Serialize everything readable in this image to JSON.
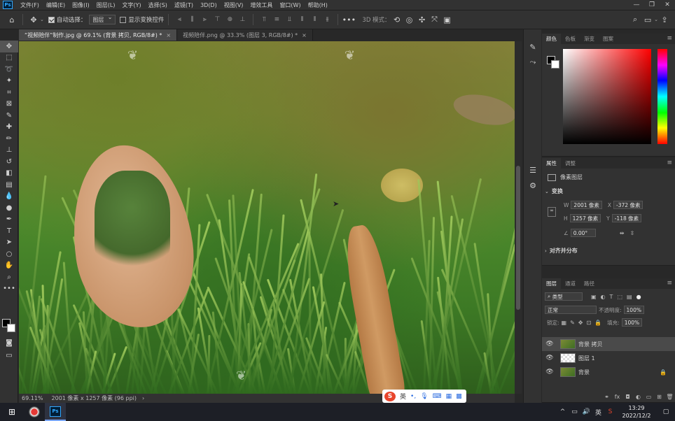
{
  "menubar": {
    "logo": "Ps",
    "items": [
      "文件(F)",
      "编辑(E)",
      "图像(I)",
      "图层(L)",
      "文字(Y)",
      "选择(S)",
      "滤镜(T)",
      "3D(D)",
      "视图(V)",
      "增效工具",
      "窗口(W)",
      "帮助(H)"
    ],
    "window_controls": [
      "—",
      "❐",
      "✕"
    ]
  },
  "options": {
    "auto_select_label": "自动选择：",
    "auto_select_value": "图层",
    "show_transform_label": "显示变换控件",
    "mode_3d_label": "3D 模式："
  },
  "tabs": [
    {
      "label": "“视频陪伴”制作.jpg @ 69.1% (背景 拷贝, RGB/8#) *",
      "close": "×"
    },
    {
      "label": "视频陪伴.png @ 33.3% (图层 3, RGB/8#) *",
      "close": "×"
    }
  ],
  "status": {
    "zoom": "69.11%",
    "doc_info": "2001 像素 x 1257 像素 (96 ppi)",
    "arrow": "›"
  },
  "ime": {
    "logo": "S",
    "lang": "英"
  },
  "color_panel": {
    "tabs": [
      "颜色",
      "色板",
      "渐变",
      "图案"
    ]
  },
  "props_panel": {
    "tabs": [
      "属性",
      "调整"
    ],
    "layer_type": "像素图层",
    "transform_title": "变换",
    "w_label": "W",
    "w_value": "2001 像素",
    "x_label": "X",
    "x_value": "-372 像素",
    "h_label": "H",
    "h_value": "1257 像素",
    "y_label": "Y",
    "y_value": "-118 像素",
    "angle_value": "0.00°",
    "align_title": "对齐并分布"
  },
  "layers_panel": {
    "tabs": [
      "图层",
      "通道",
      "路径"
    ],
    "filter_label": "类型",
    "blend_mode": "正常",
    "opacity_label": "不透明度:",
    "opacity_value": "100%",
    "lock_label": "锁定:",
    "fill_label": "填充:",
    "fill_value": "100%",
    "layers": [
      {
        "name": "背景 拷贝",
        "selected": true,
        "thumb": "grass",
        "locked": false
      },
      {
        "name": "图层 1",
        "selected": false,
        "thumb": "trans",
        "locked": false
      },
      {
        "name": "背景",
        "selected": false,
        "thumb": "grass",
        "locked": true
      }
    ],
    "footer_icons": [
      "link-icon",
      "fx-icon",
      "mask-icon",
      "adjustment-icon",
      "group-icon",
      "new-layer-icon",
      "delete-icon"
    ]
  },
  "taskbar": {
    "time": "13:29",
    "date": "2022/12/2",
    "lang": "英"
  },
  "colors": {
    "accent": "#31a8ff",
    "panel_bg": "#323232"
  }
}
